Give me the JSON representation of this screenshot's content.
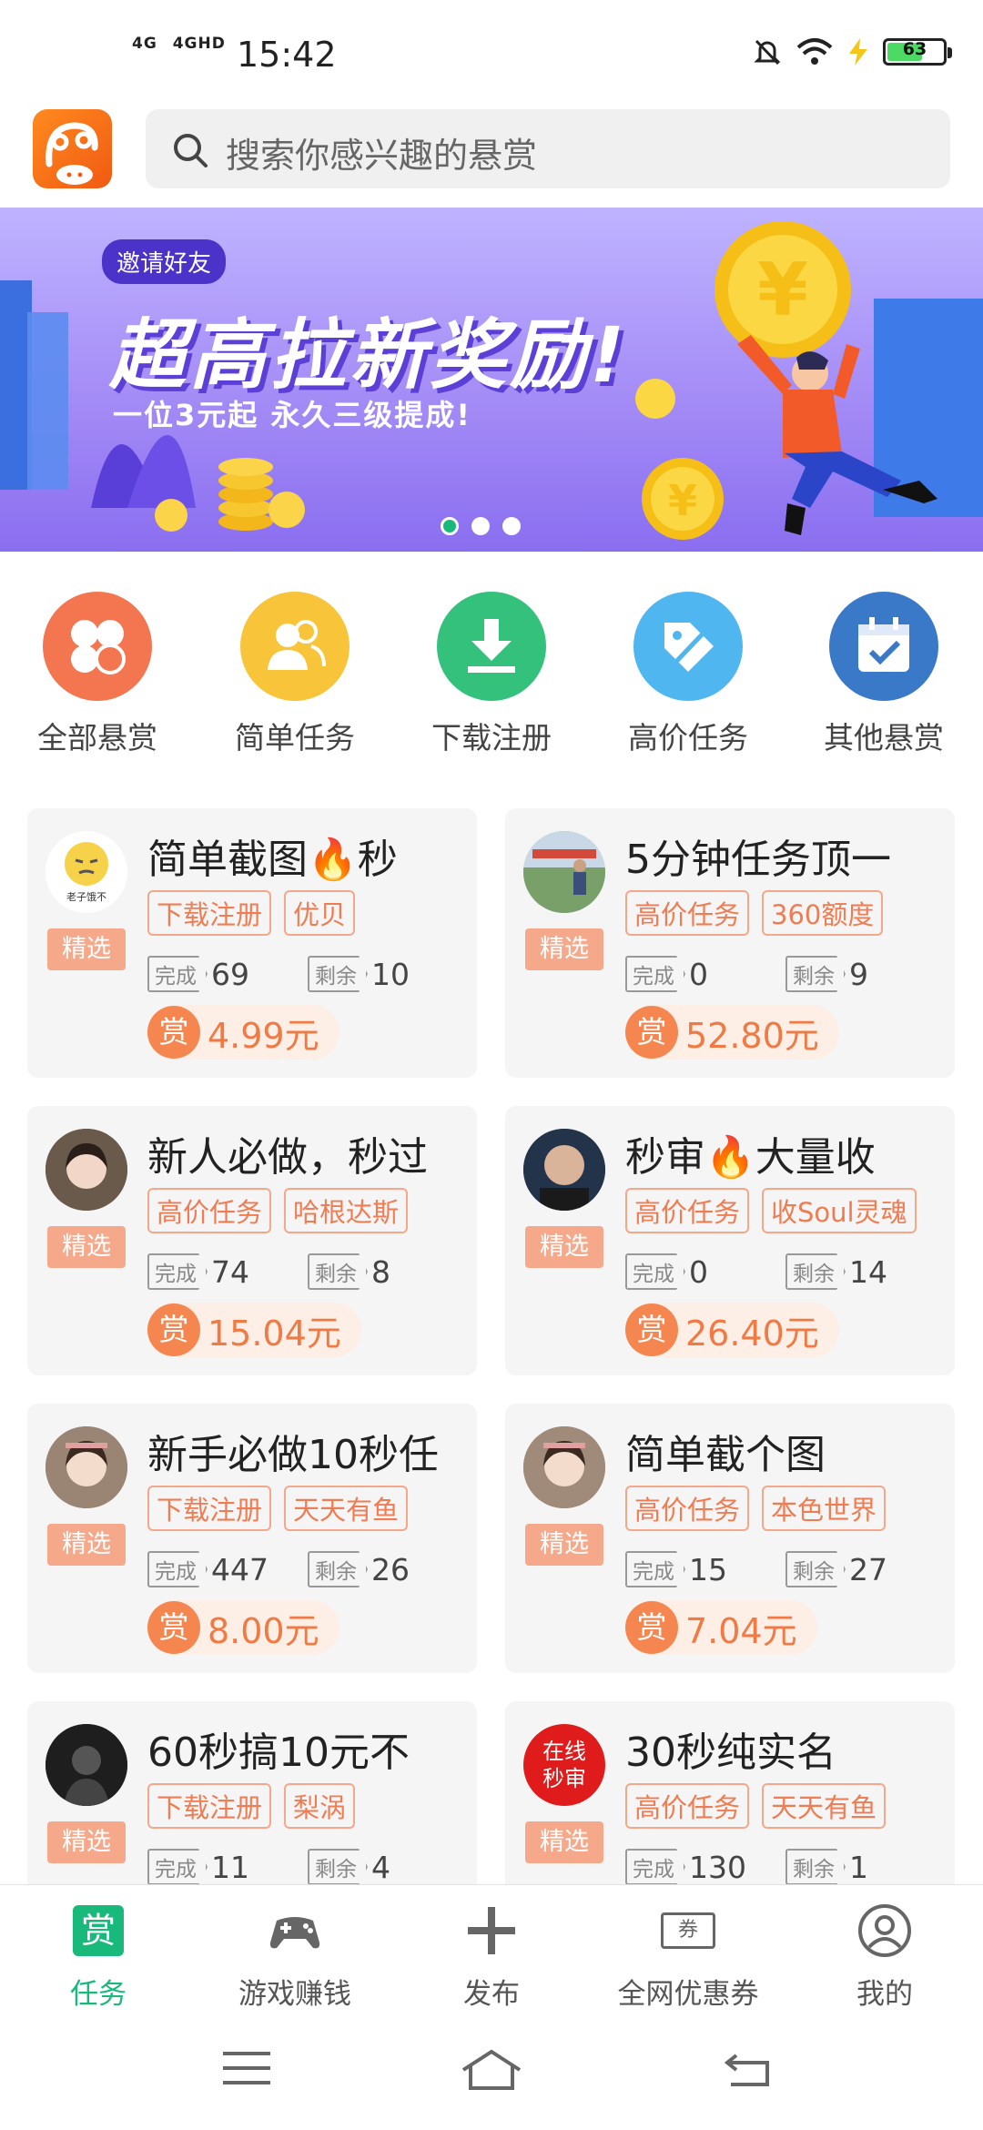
{
  "status": {
    "net1": "4G",
    "net2": "4GHD",
    "time": "15:42",
    "battery": "63"
  },
  "search": {
    "placeholder": "搜索你感兴趣的悬赏"
  },
  "banner": {
    "tag": "邀请好友",
    "headline": "超高拉新奖励!",
    "sub": "一位3元起  永久三级提成!",
    "coin_symbol": "¥"
  },
  "categories": [
    {
      "label": "全部悬赏",
      "color": "#f37651",
      "icon": "clover-icon"
    },
    {
      "label": "简单任务",
      "color": "#f8c43a",
      "icon": "users-icon"
    },
    {
      "label": "下载注册",
      "color": "#34c17b",
      "icon": "download-icon"
    },
    {
      "label": "高价任务",
      "color": "#4fb6f0",
      "icon": "price-tag-icon"
    },
    {
      "label": "其他悬赏",
      "color": "#3a78c8",
      "icon": "calendar-check-icon"
    }
  ],
  "labels": {
    "featured": "精选",
    "done": "完成",
    "left": "剩余",
    "reward_char": "赏"
  },
  "tasks": [
    {
      "title": "简单截图🔥秒",
      "tags": [
        "下载注册",
        "优贝"
      ],
      "done": "69",
      "left": "10",
      "reward": "4.99元",
      "avatar_text": "老子饿不"
    },
    {
      "title": "5分钟任务顶一",
      "tags": [
        "高价任务",
        "360额度"
      ],
      "done": "0",
      "left": "9",
      "reward": "52.80元"
    },
    {
      "title": "新人必做，秒过",
      "tags": [
        "高价任务",
        "哈根达斯"
      ],
      "done": "74",
      "left": "8",
      "reward": "15.04元"
    },
    {
      "title": "秒审🔥大量收",
      "tags": [
        "高价任务",
        "收Soul灵魂"
      ],
      "done": "0",
      "left": "14",
      "reward": "26.40元"
    },
    {
      "title": "新手必做10秒任",
      "tags": [
        "下载注册",
        "天天有鱼"
      ],
      "done": "447",
      "left": "26",
      "reward": "8.00元"
    },
    {
      "title": "简单截个图",
      "tags": [
        "高价任务",
        "本色世界"
      ],
      "done": "15",
      "left": "27",
      "reward": "7.04元"
    },
    {
      "title": "60秒搞10元不",
      "tags": [
        "下载注册",
        "梨涡"
      ],
      "done": "11",
      "left": "4",
      "reward": ""
    },
    {
      "title": "30秒纯实名",
      "tags": [
        "高价任务",
        "天天有鱼"
      ],
      "done": "130",
      "left": "1",
      "reward": "",
      "avatar_text1": "在线",
      "avatar_text2": "秒审"
    }
  ],
  "nav": [
    {
      "label": "任务",
      "icon": "reward-icon",
      "glyph": "赏"
    },
    {
      "label": "游戏赚钱",
      "icon": "gamepad-icon"
    },
    {
      "label": "发布",
      "icon": "plus-icon"
    },
    {
      "label": "全网优惠券",
      "icon": "coupon-icon",
      "glyph": "券"
    },
    {
      "label": "我的",
      "icon": "profile-icon"
    }
  ],
  "colors": {
    "accent": "#18b97a",
    "reward": "#f07a44",
    "tag_border": "#f4a889"
  }
}
